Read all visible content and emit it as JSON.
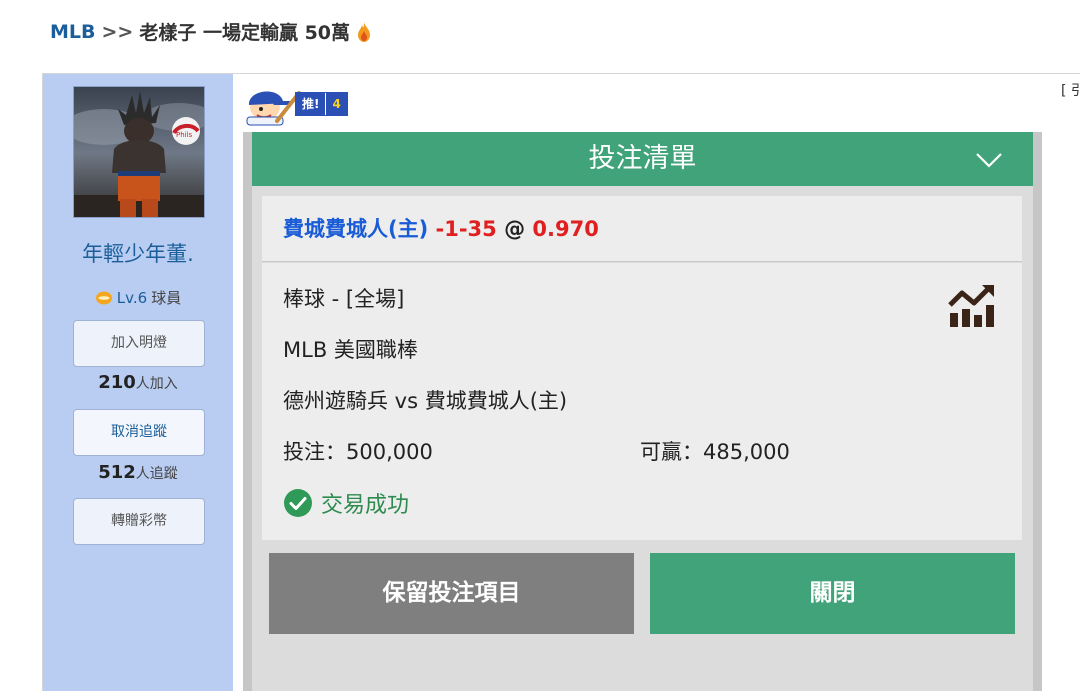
{
  "thread": {
    "forum": "MLB",
    "separator": ">>",
    "title": "老樣子 一場定輸贏 50萬"
  },
  "quote_link": "[ 引",
  "author": {
    "username": "年輕少年董.",
    "level": "Lv.6",
    "rank": "球員",
    "follow_light_button": "加入明燈",
    "follow_light_count": "210",
    "follow_light_suffix": "人加入",
    "unfollow_button": "取消追蹤",
    "tracking_count": "512",
    "tracking_suffix": "人追蹤",
    "gift_button": "轉贈彩幣"
  },
  "push": {
    "label": "推!",
    "count": "4"
  },
  "bet_slip": {
    "header": "投注清單",
    "selection": {
      "team": "費城費城人(主)",
      "line": "-1-35",
      "at": "@",
      "odds": "0.970"
    },
    "sport": "棒球 - [全場]",
    "league": "MLB 美國職棒",
    "matchup": "德州遊騎兵 vs 費城費城人(主)",
    "stake": "投注：500,000",
    "payout": "可贏：485,000",
    "status": "交易成功",
    "keep_button": "保留投注項目",
    "close_button": "關閉"
  },
  "colors": {
    "green": "#41a37a",
    "sidebar_bg": "#b9cdf2",
    "team_blue": "#1a5bd6",
    "odds_red": "#e02020"
  },
  "icons": [
    "flame-icon",
    "level-coin-icon",
    "push-mascot-icon",
    "chevron-down-icon",
    "stats-chart-icon",
    "check-circle-icon"
  ]
}
